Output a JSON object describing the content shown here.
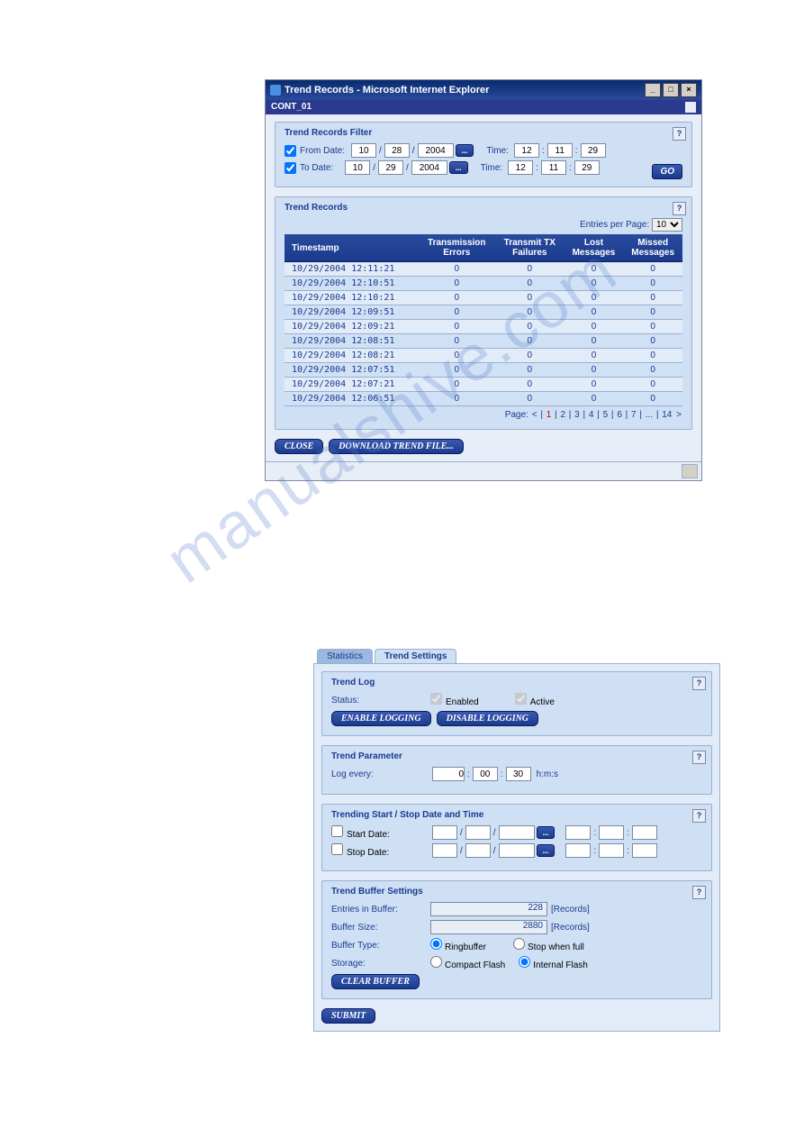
{
  "window1": {
    "title": "Trend Records - Microsoft Internet Explorer",
    "subbar": "CONT_01",
    "filter": {
      "title": "Trend Records Filter",
      "from_label": "From Date:",
      "to_label": "To Date:",
      "from": {
        "m": "10",
        "d": "28",
        "y": "2004",
        "hh": "12",
        "mm": "11",
        "ss": "29"
      },
      "to": {
        "m": "10",
        "d": "29",
        "y": "2004",
        "hh": "12",
        "mm": "11",
        "ss": "29"
      },
      "time_label": "Time:",
      "btn_ellipsis": "...",
      "go": "GO"
    },
    "records": {
      "title": "Trend Records",
      "entries_label": "Entries per Page:",
      "entries_value": "10",
      "cols": [
        "Timestamp",
        "Transmission Errors",
        "Transmit TX Failures",
        "Lost Messages",
        "Missed Messages"
      ],
      "rows": [
        [
          "10/29/2004 12:11:21",
          "0",
          "0",
          "0",
          "0"
        ],
        [
          "10/29/2004 12:10:51",
          "0",
          "0",
          "0",
          "0"
        ],
        [
          "10/29/2004 12:10:21",
          "0",
          "0",
          "0",
          "0"
        ],
        [
          "10/29/2004 12:09:51",
          "0",
          "0",
          "0",
          "0"
        ],
        [
          "10/29/2004 12:09:21",
          "0",
          "0",
          "0",
          "0"
        ],
        [
          "10/29/2004 12:08:51",
          "0",
          "0",
          "0",
          "0"
        ],
        [
          "10/29/2004 12:08:21",
          "0",
          "0",
          "0",
          "0"
        ],
        [
          "10/29/2004 12:07:51",
          "0",
          "0",
          "0",
          "0"
        ],
        [
          "10/29/2004 12:07:21",
          "0",
          "0",
          "0",
          "0"
        ],
        [
          "10/29/2004 12:06:51",
          "0",
          "0",
          "0",
          "0"
        ]
      ],
      "pager_label": "Page:",
      "pager_pages": [
        "1",
        "2",
        "3",
        "4",
        "5",
        "6",
        "7",
        "...",
        "14"
      ]
    },
    "btn_close": "CLOSE",
    "btn_download": "DOWNLOAD TREND FILE..."
  },
  "window2": {
    "tabs": {
      "statistics": "Statistics",
      "trend_settings": "Trend Settings"
    },
    "trend_log": {
      "title": "Trend Log",
      "status_label": "Status:",
      "enabled": "Enabled",
      "active": "Active",
      "btn_enable": "ENABLE LOGGING",
      "btn_disable": "DISABLE LOGGING"
    },
    "trend_param": {
      "title": "Trend Parameter",
      "log_every": "Log every:",
      "h": "0",
      "m": "00",
      "s": "30",
      "unit": "h:m:s"
    },
    "trend_start": {
      "title": "Trending Start / Stop Date and Time",
      "start": "Start Date:",
      "stop": "Stop Date:",
      "btn_ellipsis": "..."
    },
    "trend_buffer": {
      "title": "Trend Buffer Settings",
      "entries_label": "Entries in Buffer:",
      "entries_val": "228",
      "size_label": "Buffer Size:",
      "size_val": "2880",
      "records_unit": "[Records]",
      "type_label": "Buffer Type:",
      "type_ring": "Ringbuffer",
      "type_stop": "Stop when full",
      "storage_label": "Storage:",
      "storage_cf": "Compact Flash",
      "storage_if": "Internal Flash",
      "btn_clear": "CLEAR BUFFER"
    },
    "btn_submit": "SUBMIT"
  },
  "watermark": "manualshive.com"
}
